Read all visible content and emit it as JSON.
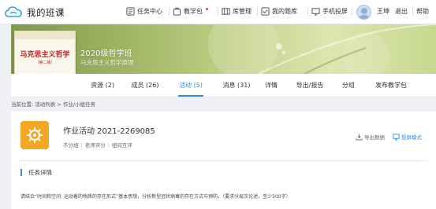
{
  "app": {
    "brand": "我的班课"
  },
  "header": {
    "nav": [
      {
        "label": "任务中心",
        "icon": "task-center-icon"
      },
      {
        "label": "教学包",
        "icon": "teaching-package-icon",
        "badge": true
      },
      {
        "label": "库管理",
        "icon": "library-icon"
      },
      {
        "label": "我的题库",
        "icon": "question-bank-icon"
      },
      {
        "label": "手机投屏",
        "icon": "phone-cast-icon"
      }
    ],
    "user": "王坤",
    "logout": "退出",
    "help": "帮助"
  },
  "banner": {
    "class_name": "2020级哲学班",
    "course_name": "马克思主义哲学原理",
    "cover_title": "马克思主义哲学",
    "cover_subtitle": "（第二版）"
  },
  "tabs": [
    {
      "label": "资源 (2)"
    },
    {
      "label": "成员 (26)"
    },
    {
      "label": "活动 (5)",
      "active": true
    },
    {
      "label": "消息 (31)"
    },
    {
      "label": "详情"
    },
    {
      "label": "导出/报告"
    },
    {
      "label": "分组"
    },
    {
      "label": "发布教学包"
    }
  ],
  "breadcrumb": "当前位置: 活动列表 > 作业/小组任务",
  "activity": {
    "title": "作业活动 2021-2269085",
    "meta": [
      "不分组",
      "老师评分",
      "组间互评"
    ],
    "export_label": "导出数据",
    "project_label": "投屏模式"
  },
  "task": {
    "section_title": "任务详情",
    "description": "请结合“时间和空间: 运动着的物质的存在形式”基本思想，分析新型冠状病毒的存在方式与预防。（要求分层次论述，至少500字）"
  },
  "colors": {
    "accent": "#2f8be6",
    "activity_icon": "#f5a623",
    "logo": "#29a8e0"
  }
}
